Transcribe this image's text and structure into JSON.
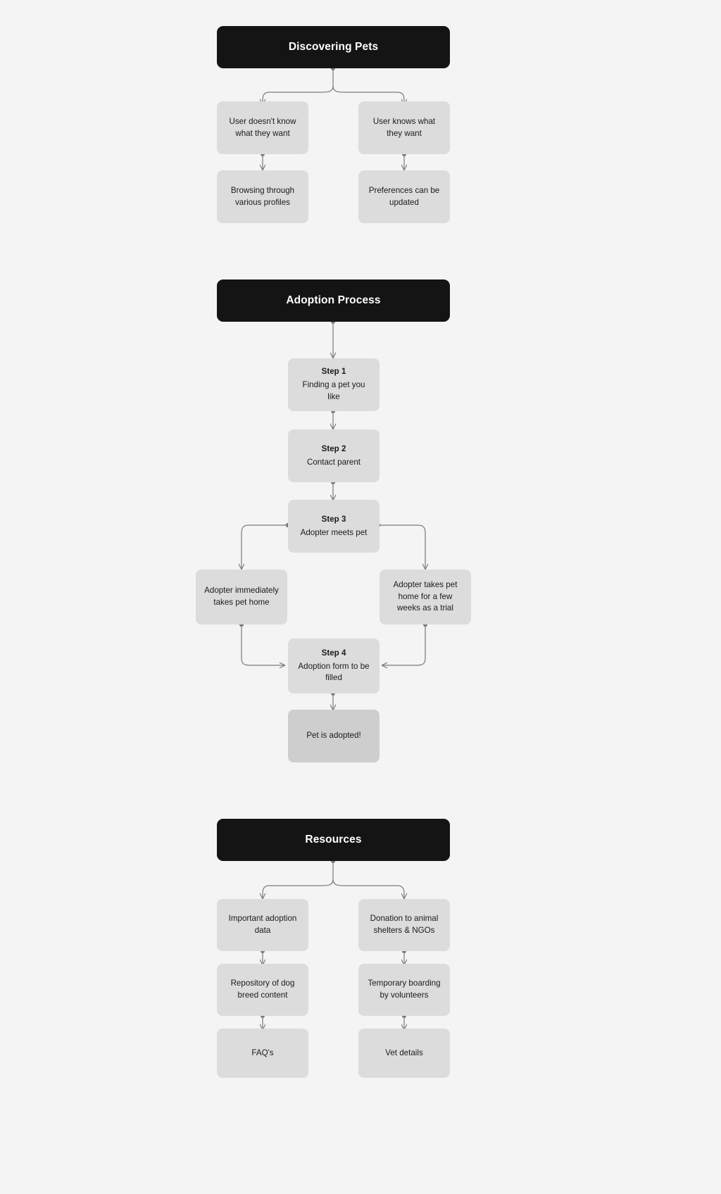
{
  "page": {
    "background_color": "#f4f4f4",
    "section_color": "#141414",
    "node_color": "#dcdcdc",
    "highlight_color": "#cecece",
    "edge_color": "#7a7a7a"
  },
  "sections": [
    {
      "id": "discovering-pets",
      "title": "Discovering Pets",
      "nodes": [
        {
          "id": "dp-left-1",
          "text": "User doesn't know what they want"
        },
        {
          "id": "dp-right-1",
          "text": "User knows what they want"
        },
        {
          "id": "dp-left-2",
          "text": "Browsing through various profiles"
        },
        {
          "id": "dp-right-2",
          "text": "Preferences can be updated"
        }
      ]
    },
    {
      "id": "adoption-process",
      "title": "Adoption Process",
      "nodes": [
        {
          "id": "ap-step1",
          "step": "Step 1",
          "text": "Finding a pet you like"
        },
        {
          "id": "ap-step2",
          "step": "Step 2",
          "text": "Contact parent"
        },
        {
          "id": "ap-step3",
          "step": "Step 3",
          "text": "Adopter meets pet"
        },
        {
          "id": "ap-branch-left",
          "text": "Adopter immediately takes pet home"
        },
        {
          "id": "ap-branch-right",
          "text": "Adopter takes pet home for a few weeks as a trial"
        },
        {
          "id": "ap-step4",
          "step": "Step 4",
          "text": "Adoption form to be filled"
        },
        {
          "id": "ap-final",
          "text": "Pet is adopted!"
        }
      ]
    },
    {
      "id": "resources",
      "title": "Resources",
      "nodes": [
        {
          "id": "rs-left-1",
          "text": "Important adoption data"
        },
        {
          "id": "rs-right-1",
          "text": "Donation to animal shelters & NGOs"
        },
        {
          "id": "rs-left-2",
          "text": "Repository of dog breed content"
        },
        {
          "id": "rs-right-2",
          "text": "Temporary boarding by volunteers"
        },
        {
          "id": "rs-left-3",
          "text": "FAQ's"
        },
        {
          "id": "rs-right-3",
          "text": "Vet details"
        }
      ]
    }
  ]
}
